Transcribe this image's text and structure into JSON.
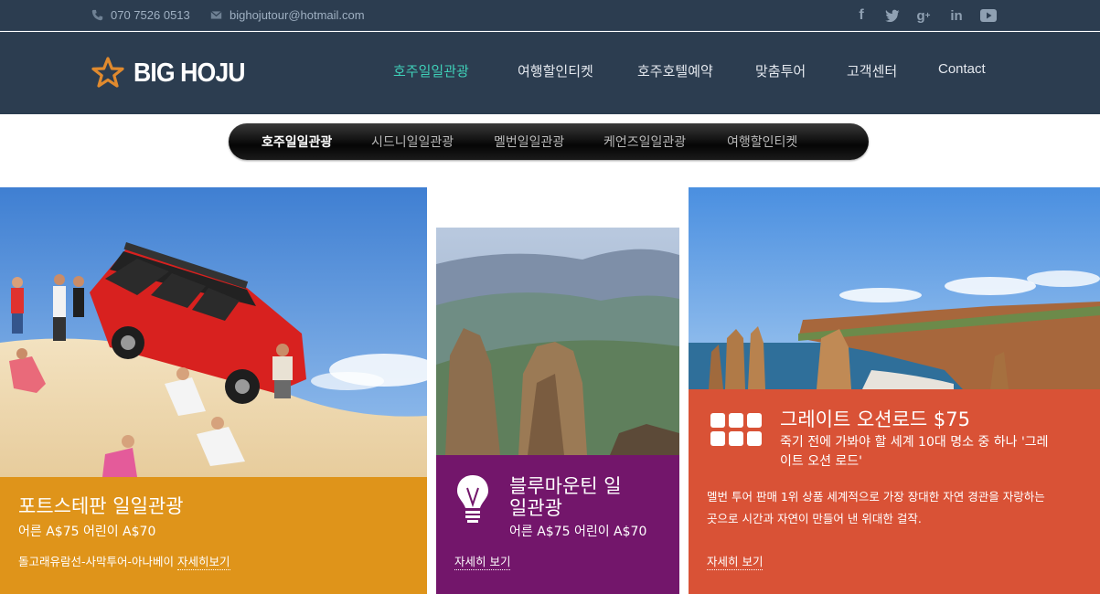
{
  "topbar": {
    "phone": "070 7526 0513",
    "email": "bighojutour@hotmail.com",
    "social": [
      "facebook-icon",
      "twitter-icon",
      "google-plus-icon",
      "linkedin-icon",
      "youtube-icon"
    ]
  },
  "header": {
    "logo_text": "BIG HOJU",
    "nav": [
      "호주일일관광",
      "여행할인티켓",
      "호주호텔예약",
      "맞춤투어",
      "고객센터",
      "Contact"
    ]
  },
  "subnav": [
    "호주일일관광",
    "시드니일일관광",
    "멜번일일관광",
    "케언즈일일관광",
    "여행할인티켓"
  ],
  "cards": [
    {
      "title": "포트스테판 일일관광",
      "price": "어른 A$75 어린이 A$70",
      "desc": "돌고래유람선-사막투어-아나베이",
      "more": "자세히보기",
      "color": "#df941a"
    },
    {
      "title_line1": "블루마운틴 일",
      "title_line2": "일관광",
      "price": "어른 A$75 어린이 A$70",
      "more": "자세히 보기",
      "color": "#73166b"
    },
    {
      "title": "그레이트 오션로드 $75",
      "subtitle_line1": "죽기 전에 가봐야 할 세계 10대 명소 중 하나 '그레",
      "subtitle_line2": "이트 오션 로드'",
      "desc_line1": "멜번 투어 판매 1위 상품 세계적으로 가장 장대한 자연 경관을 자랑하는",
      "desc_line2": "곳으로 시간과 자연이 만들어 낸 위대한 걸작.",
      "more": "자세히 보기",
      "color": "#d95236"
    }
  ]
}
